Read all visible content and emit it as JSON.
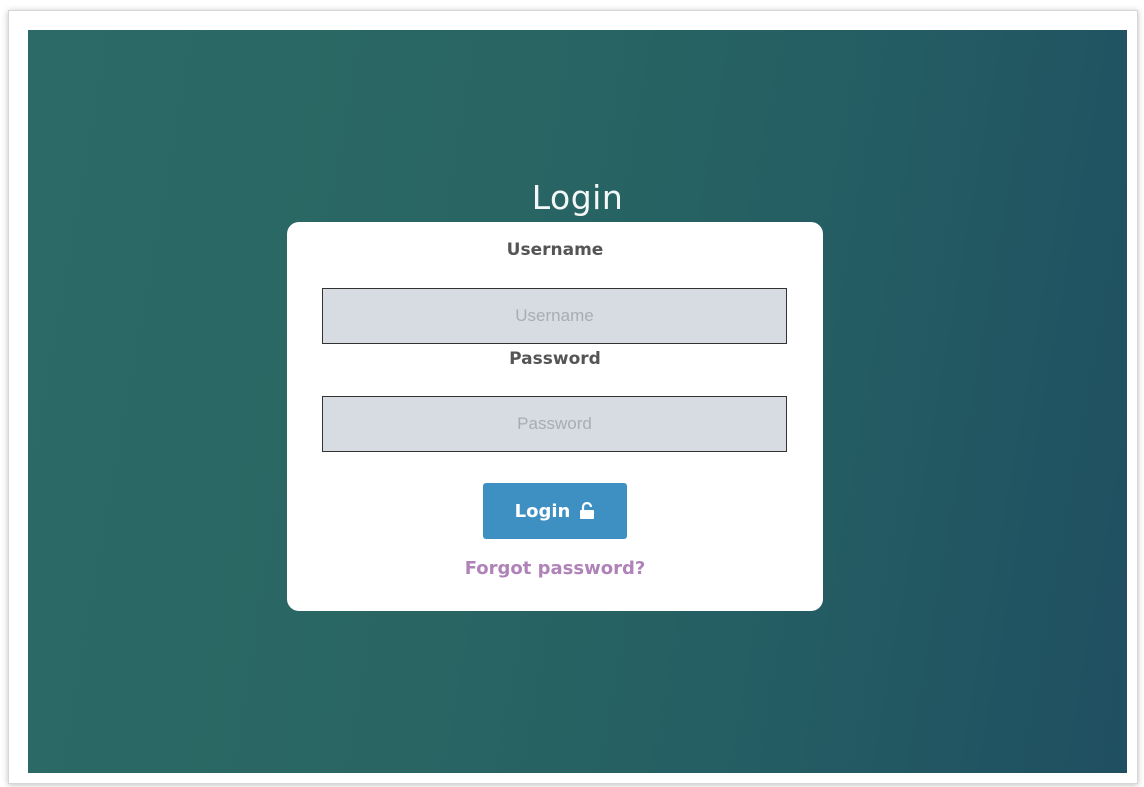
{
  "page": {
    "title": "Login"
  },
  "form": {
    "username_label": "Username",
    "username_placeholder": "Username",
    "username_value": "",
    "password_label": "Password",
    "password_placeholder": "Password",
    "password_value": "",
    "login_button_label": "Login",
    "login_button_icon": "unlock-icon",
    "forgot_password_label": "Forgot password?"
  },
  "colors": {
    "background_start": "#2b6a67",
    "background_end": "#1f4f61",
    "card": "#ffffff",
    "input_fill": "#d7dbe2",
    "button": "#3e8fc2",
    "link": "#b083b8",
    "label_text": "#555555"
  }
}
